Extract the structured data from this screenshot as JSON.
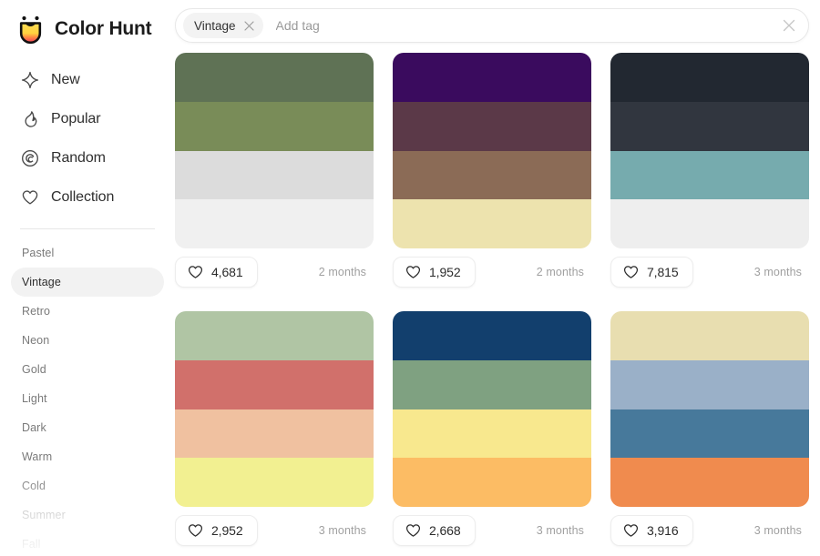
{
  "brand": {
    "name": "Color Hunt",
    "logo_icon": "colorhunt-smiley-logo",
    "logo_gradient": [
      "#FFDD55",
      "#FF9F43",
      "#F2385A"
    ]
  },
  "sidebar": {
    "nav": [
      {
        "label": "New",
        "icon": "sparkle-icon",
        "active": false
      },
      {
        "label": "Popular",
        "icon": "flame-icon",
        "active": false
      },
      {
        "label": "Random",
        "icon": "spiral-icon",
        "active": false
      },
      {
        "label": "Collection",
        "icon": "heart-icon",
        "active": false
      }
    ],
    "tags": [
      {
        "label": "Pastel",
        "active": false
      },
      {
        "label": "Vintage",
        "active": true
      },
      {
        "label": "Retro",
        "active": false
      },
      {
        "label": "Neon",
        "active": false
      },
      {
        "label": "Gold",
        "active": false
      },
      {
        "label": "Light",
        "active": false
      },
      {
        "label": "Dark",
        "active": false
      },
      {
        "label": "Warm",
        "active": false
      },
      {
        "label": "Cold",
        "active": false
      },
      {
        "label": "Summer",
        "active": false
      },
      {
        "label": "Fall",
        "active": false
      }
    ]
  },
  "search": {
    "chip_label": "Vintage",
    "chip_close_icon": "close-icon",
    "placeholder": "Add tag",
    "value": "",
    "clear_icon": "close-icon"
  },
  "palettes": [
    {
      "colors": [
        "#5F7255",
        "#798C58",
        "#DCDCDC",
        "#F0F0F0"
      ],
      "likes": "4,681",
      "time": "2 months",
      "like_icon": "heart-icon"
    },
    {
      "colors": [
        "#3A0B5E",
        "#5B3948",
        "#8B6B56",
        "#EDE3AE"
      ],
      "likes": "1,952",
      "time": "2 months",
      "like_icon": "heart-icon"
    },
    {
      "colors": [
        "#222831",
        "#31363F",
        "#76ABAE",
        "#EEEEEE"
      ],
      "likes": "7,815",
      "time": "3 months",
      "like_icon": "heart-icon"
    },
    {
      "colors": [
        "#B0C5A4",
        "#D1706B",
        "#F0C1A0",
        "#F2F091"
      ],
      "likes": "2,952",
      "time": "3 months",
      "like_icon": "heart-icon"
    },
    {
      "colors": [
        "#123F6D",
        "#7FA181",
        "#F8E88E",
        "#FCBC64"
      ],
      "likes": "2,668",
      "time": "3 months",
      "like_icon": "heart-icon"
    },
    {
      "colors": [
        "#E8DEB0",
        "#9AB0C8",
        "#47799B",
        "#F08B4E"
      ],
      "likes": "3,916",
      "time": "3 months",
      "like_icon": "heart-icon"
    }
  ]
}
